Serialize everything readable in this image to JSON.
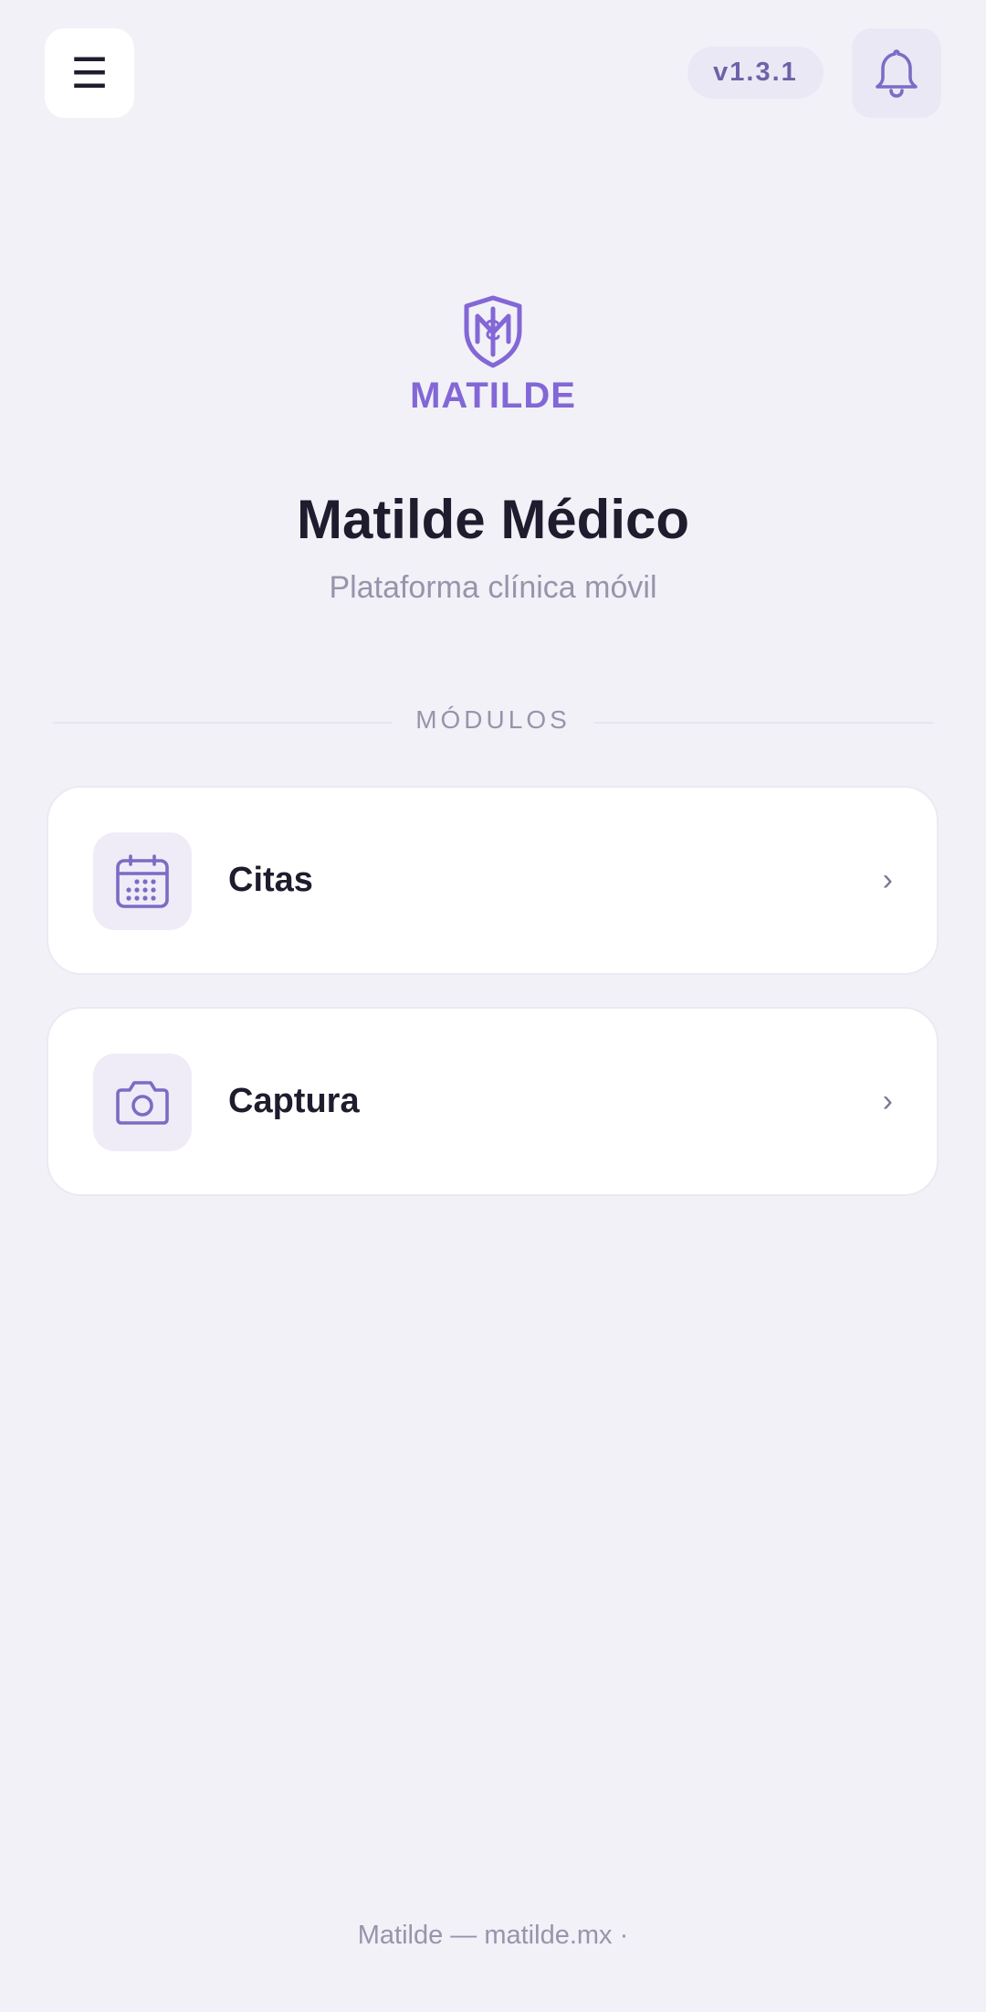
{
  "header": {
    "menu_icon": "☰",
    "version": "v1.3.1",
    "notification_icon": "bell-icon"
  },
  "logo": {
    "text": "MATILDE"
  },
  "hero": {
    "title": "Matilde Médico",
    "subtitle": "Plataforma clínica móvil"
  },
  "section": {
    "label": "MÓDULOS"
  },
  "modules": [
    {
      "label": "Citas",
      "icon": "calendar-icon",
      "chevron": "›"
    },
    {
      "label": "Captura",
      "icon": "camera-icon",
      "chevron": "›"
    }
  ],
  "footer": {
    "text": "Matilde — matilde.mx ·"
  },
  "colors": {
    "background": "#f2f1f8",
    "accent": "#8367d6",
    "icon_stroke": "#7b6cc4",
    "text_primary": "#1e1c2d",
    "text_muted": "#9894ab"
  }
}
